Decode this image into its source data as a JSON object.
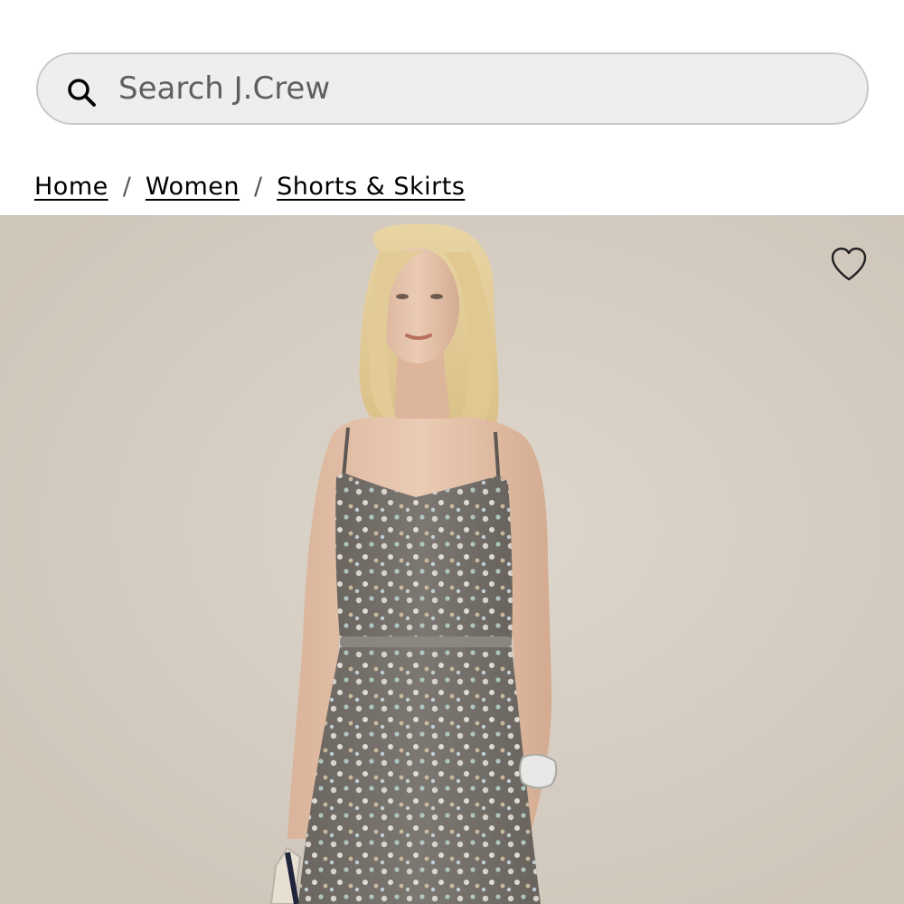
{
  "search": {
    "placeholder": "Search J.Crew",
    "icon": "search-icon"
  },
  "breadcrumb": {
    "items": [
      "Home",
      "Women",
      "Shorts & Skirts"
    ],
    "separator": "/"
  },
  "product": {
    "image_alt": "Model wearing grey sequin-embellished camisole and matching midi slip skirt",
    "wishlist_icon": "heart-outline-icon"
  },
  "colors": {
    "search_bg": "#eeeeee",
    "search_border": "#c8c8c8",
    "backdrop": "#d8d0c5",
    "garment": "#77726c"
  }
}
